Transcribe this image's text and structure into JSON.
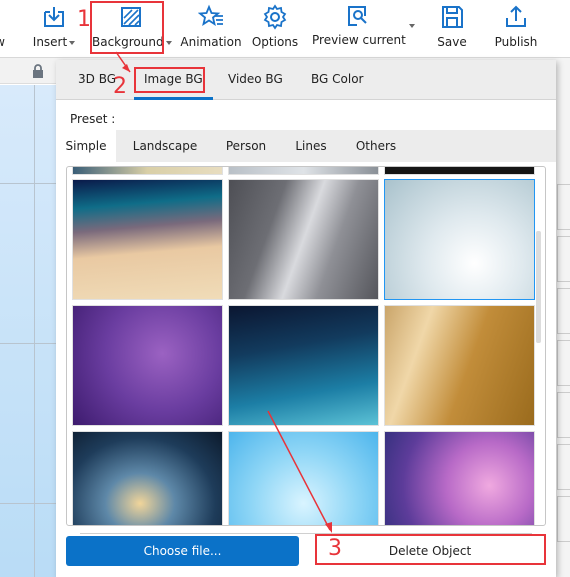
{
  "toolbar": {
    "items": [
      {
        "label": "w",
        "icon": "view-icon"
      },
      {
        "label": "Insert",
        "icon": "insert-icon",
        "has_dropdown": true
      },
      {
        "label": "Background",
        "icon": "background-icon",
        "has_dropdown": true
      },
      {
        "label": "Animation",
        "icon": "animation-icon"
      },
      {
        "label": "Options",
        "icon": "gear-icon"
      },
      {
        "label": "Preview current",
        "icon": "preview-icon",
        "has_dropdown": true
      },
      {
        "label": "Save",
        "icon": "save-icon"
      },
      {
        "label": "Publish",
        "icon": "publish-icon"
      }
    ]
  },
  "panel": {
    "main_tabs": [
      "3D BG",
      "Image BG",
      "Video BG",
      "BG Color"
    ],
    "active_main_tab": "Image BG",
    "preset_label": "Preset :",
    "sub_tabs": [
      "Simple",
      "Landscape",
      "Person",
      "Lines",
      "Others"
    ],
    "active_sub_tab": "Simple",
    "thumbnails": [
      {
        "name": "sunset-sand-gradient"
      },
      {
        "name": "brushed-steel"
      },
      {
        "name": "snowflakes",
        "selected": true
      },
      {
        "name": "purple-sparkles"
      },
      {
        "name": "blue-space-nebula"
      },
      {
        "name": "brushed-gold"
      },
      {
        "name": "galaxy"
      },
      {
        "name": "light-blue-bokeh"
      },
      {
        "name": "purple-pink-glow"
      }
    ],
    "choose_file_label": "Choose file...",
    "delete_object_label": "Delete Object"
  },
  "annotations": {
    "step1": "1",
    "step2": "2",
    "step3": "3",
    "color": "#e8343a"
  },
  "colors": {
    "accent": "#0b72c8",
    "selection": "#2196f3"
  }
}
